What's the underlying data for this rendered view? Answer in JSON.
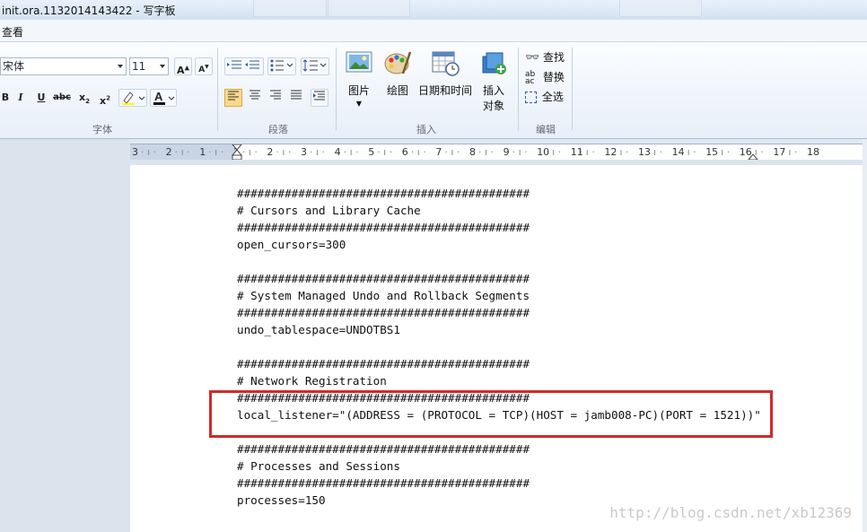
{
  "window": {
    "title": "init.ora.1132014143422 - 写字板"
  },
  "menu": {
    "view_label": "查看"
  },
  "ribbon": {
    "font_group": {
      "label": "字体",
      "font_name": "宋体",
      "font_size": "11"
    },
    "paragraph_group": {
      "label": "段落"
    },
    "insert_group": {
      "label": "插入",
      "picture_label": "图片",
      "paint_label": "绘图",
      "datetime_label": "日期和时间",
      "object_label_line1": "插入",
      "object_label_line2": "对象"
    },
    "edit_group": {
      "label": "编辑",
      "find_label": "查找",
      "replace_label": "替换",
      "selectall_label": "全选"
    }
  },
  "ruler": {
    "numbers": [
      "3",
      "2",
      "1",
      "1",
      "2",
      "3",
      "4",
      "5",
      "6",
      "7",
      "8",
      "9",
      "10",
      "11",
      "12",
      "13",
      "14",
      "15",
      "16",
      "17",
      "18"
    ]
  },
  "document": {
    "lines": [
      "###########################################",
      "# Cursors and Library Cache",
      "###########################################",
      "open_cursors=300",
      "",
      "###########################################",
      "# System Managed Undo and Rollback Segments",
      "###########################################",
      "undo_tablespace=UNDOTBS1",
      "",
      "###########################################",
      "# Network Registration",
      "###########################################",
      "local_listener=\"(ADDRESS = (PROTOCOL = TCP)(HOST = jamb008-PC)(PORT = 1521))\"",
      "",
      "###########################################",
      "# Processes and Sessions",
      "###########################################",
      "processes=150"
    ]
  },
  "watermark": "http://blog.csdn.net/xb12369",
  "colors": {
    "highlight": "#d12a2a",
    "ribbon_bg": "#e8eff8"
  }
}
